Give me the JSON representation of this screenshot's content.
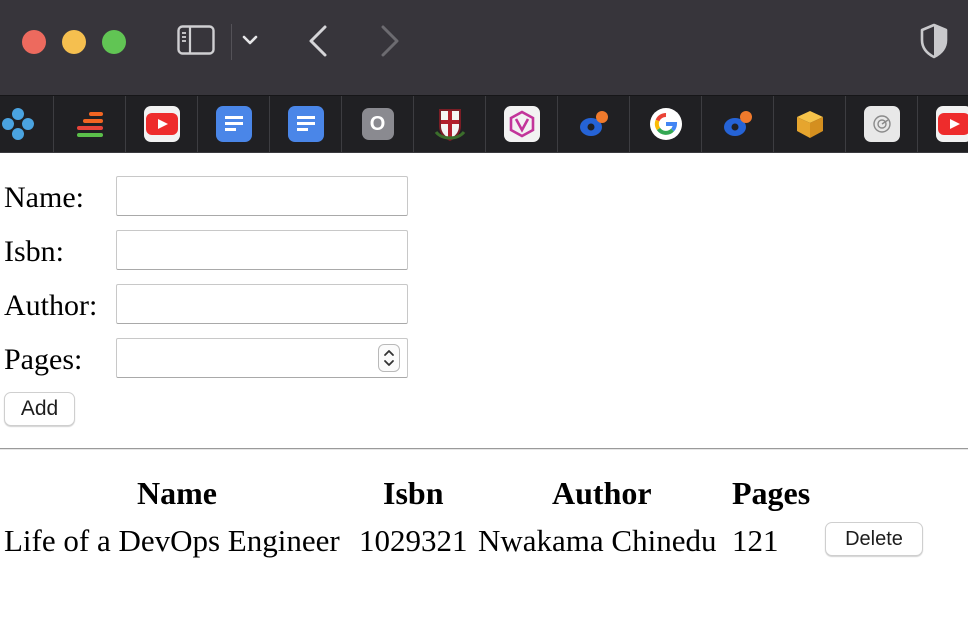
{
  "browser": {
    "favorites": [
      {
        "name": "grid-app",
        "bg": "transparent"
      },
      {
        "name": "stack-app",
        "bg": "transparent"
      },
      {
        "name": "youtube",
        "bg": "#f2f2f2"
      },
      {
        "name": "google-docs",
        "bg": "#4a86e8"
      },
      {
        "name": "google-docs",
        "bg": "#4a86e8"
      },
      {
        "name": "o-app",
        "bg": "#8a8a90",
        "letter": "O"
      },
      {
        "name": "crest",
        "bg": "transparent"
      },
      {
        "name": "v-app",
        "bg": "#f2f2f2"
      },
      {
        "name": "bubble-app",
        "bg": "transparent"
      },
      {
        "name": "google",
        "bg": "#ffffff"
      },
      {
        "name": "bubble-app",
        "bg": "transparent"
      },
      {
        "name": "box-app",
        "bg": "transparent"
      },
      {
        "name": "spiral-app",
        "bg": "#e8e8e8"
      },
      {
        "name": "youtube",
        "bg": "#f2f2f2"
      }
    ]
  },
  "form": {
    "name_label": "Name:",
    "isbn_label": "Isbn:",
    "author_label": "Author:",
    "pages_label": "Pages:",
    "name_value": "",
    "isbn_value": "",
    "author_value": "",
    "pages_value": "",
    "add_label": "Add"
  },
  "table": {
    "headers": [
      "Name",
      "Isbn",
      "Author",
      "Pages"
    ],
    "rows": [
      {
        "name": "Life of a DevOps Engineer",
        "isbn": "1029321",
        "author": "Nwakama Chinedu",
        "pages": "121",
        "delete_label": "Delete"
      }
    ]
  }
}
